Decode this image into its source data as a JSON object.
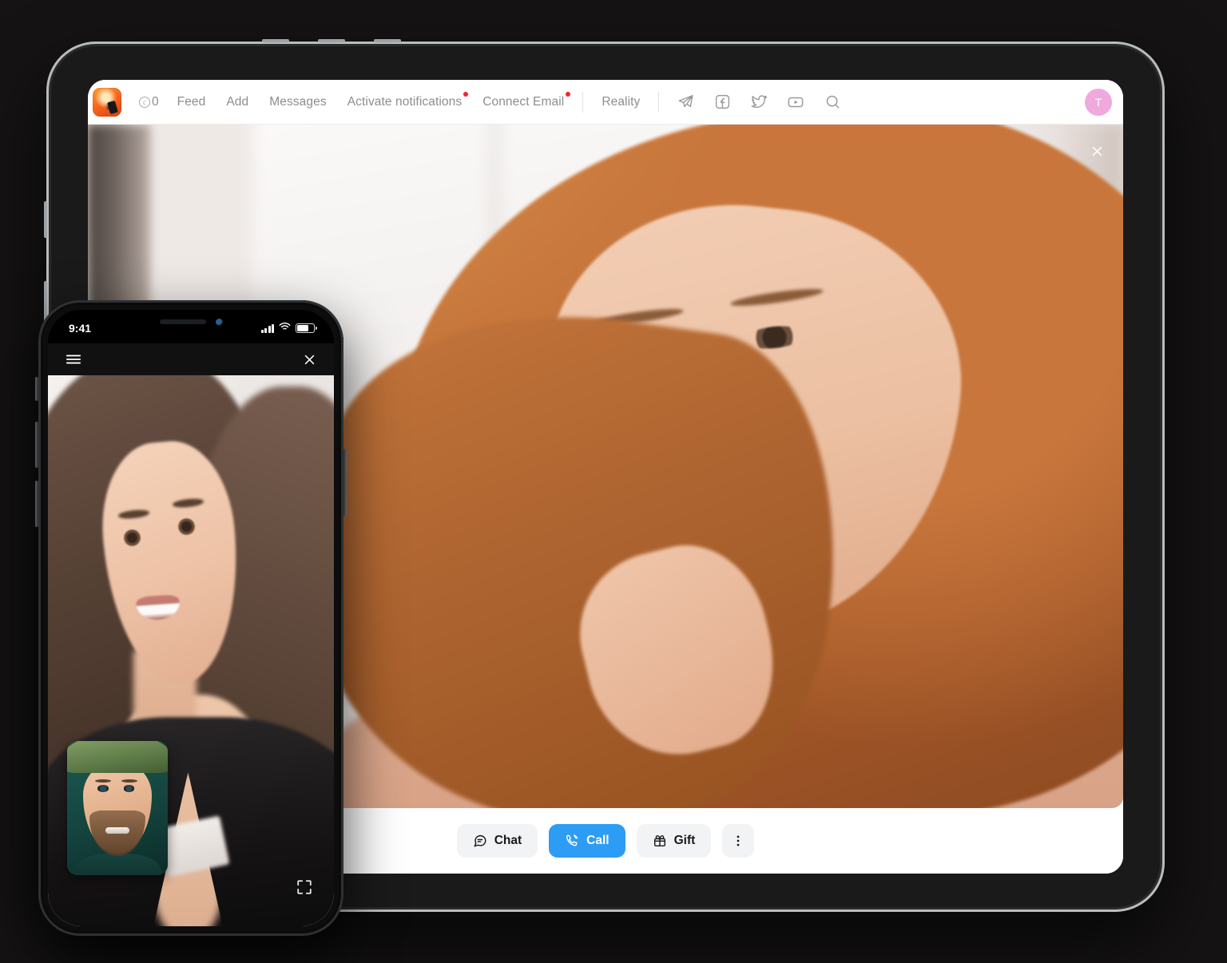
{
  "tablet": {
    "nav": {
      "logo_icon": "app-logo-avatar",
      "coin_icon": "coin-icon",
      "coin_value": "0",
      "links": [
        {
          "label": "Feed",
          "has_dot": false
        },
        {
          "label": "Add",
          "has_dot": false
        },
        {
          "label": "Messages",
          "has_dot": false
        },
        {
          "label": "Activate notifications",
          "has_dot": true
        },
        {
          "label": "Connect Email",
          "has_dot": true
        }
      ],
      "reality_label": "Reality",
      "social_icons": [
        {
          "name": "telegram-icon"
        },
        {
          "name": "facebook-icon"
        },
        {
          "name": "twitter-icon"
        },
        {
          "name": "youtube-icon"
        },
        {
          "name": "search-icon"
        }
      ],
      "avatar_initial": "T"
    },
    "video": {
      "close_icon": "close-icon",
      "subject": "woman with long auburn red hair, hand near chin, bright window background"
    },
    "actions": [
      {
        "label": "Chat",
        "icon": "chat-bubble-icon",
        "style": "default"
      },
      {
        "label": "Call",
        "icon": "phone-call-icon",
        "style": "primary"
      },
      {
        "label": "Gift",
        "icon": "gift-icon",
        "style": "default"
      },
      {
        "label": "",
        "icon": "more-vertical-icon",
        "style": "icon-only"
      }
    ]
  },
  "phone": {
    "status": {
      "time": "9:41",
      "signal_icon": "cellular-signal-icon",
      "wifi_icon": "wifi-icon",
      "battery_icon": "battery-icon"
    },
    "toolbar": {
      "menu_icon": "hamburger-menu-icon",
      "close_icon": "close-icon"
    },
    "video": {
      "subject": "smiling woman with long brown hair in black top",
      "pip_subject": "smiling man with green flat cap",
      "fullscreen_icon": "fullscreen-expand-icon"
    }
  },
  "colors": {
    "background": "#151314",
    "primary_blue": "#2d9cf5",
    "notification_red": "#f5252c",
    "avatar_pink": "#f0a9dc",
    "nav_text": "#8b8e91",
    "button_grey": "#f2f3f4"
  }
}
